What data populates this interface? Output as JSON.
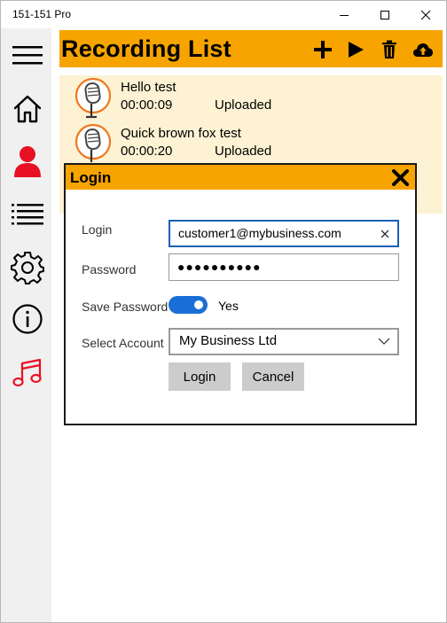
{
  "window": {
    "title": "151-151 Pro",
    "icons": [
      "minimize-icon",
      "maximize-icon",
      "close-icon"
    ]
  },
  "sidebar": {
    "items": [
      {
        "icon": "hamburger-menu-icon"
      },
      {
        "icon": "home-icon"
      },
      {
        "icon": "user-icon",
        "color": "#e81123"
      },
      {
        "icon": "list-icon"
      },
      {
        "icon": "gear-icon"
      },
      {
        "icon": "info-icon"
      },
      {
        "icon": "music-note-icon",
        "color": "#e81123"
      }
    ]
  },
  "header": {
    "title": "Recording List",
    "background": "#f7a400",
    "actions": [
      "plus-icon",
      "play-icon",
      "trash-icon",
      "cloud-upload-icon"
    ]
  },
  "recordings": [
    {
      "name": "Hello test",
      "duration": "00:00:09",
      "status": "Uploaded",
      "icon": "microphone-icon"
    },
    {
      "name": "Quick brown fox test",
      "duration": "00:00:20",
      "status": "Uploaded",
      "icon": "microphone-icon"
    }
  ],
  "dialog": {
    "title": "Login",
    "close_icon": "close-x-icon",
    "login_label": "Login",
    "login_value": "customer1@mybusiness.com",
    "password_label": "Password",
    "password_value": "●●●●●●●●●●",
    "save_password_label": "Save Password",
    "save_password_state": "Yes",
    "select_account_label": "Select Account",
    "select_account_value": "My Business Ltd",
    "login_button": "Login",
    "cancel_button": "Cancel"
  },
  "colors": {
    "accent": "#f7a400",
    "list_bg": "#fdf2d3",
    "toggle_on": "#1a6fd6",
    "nav_red": "#e81123"
  }
}
